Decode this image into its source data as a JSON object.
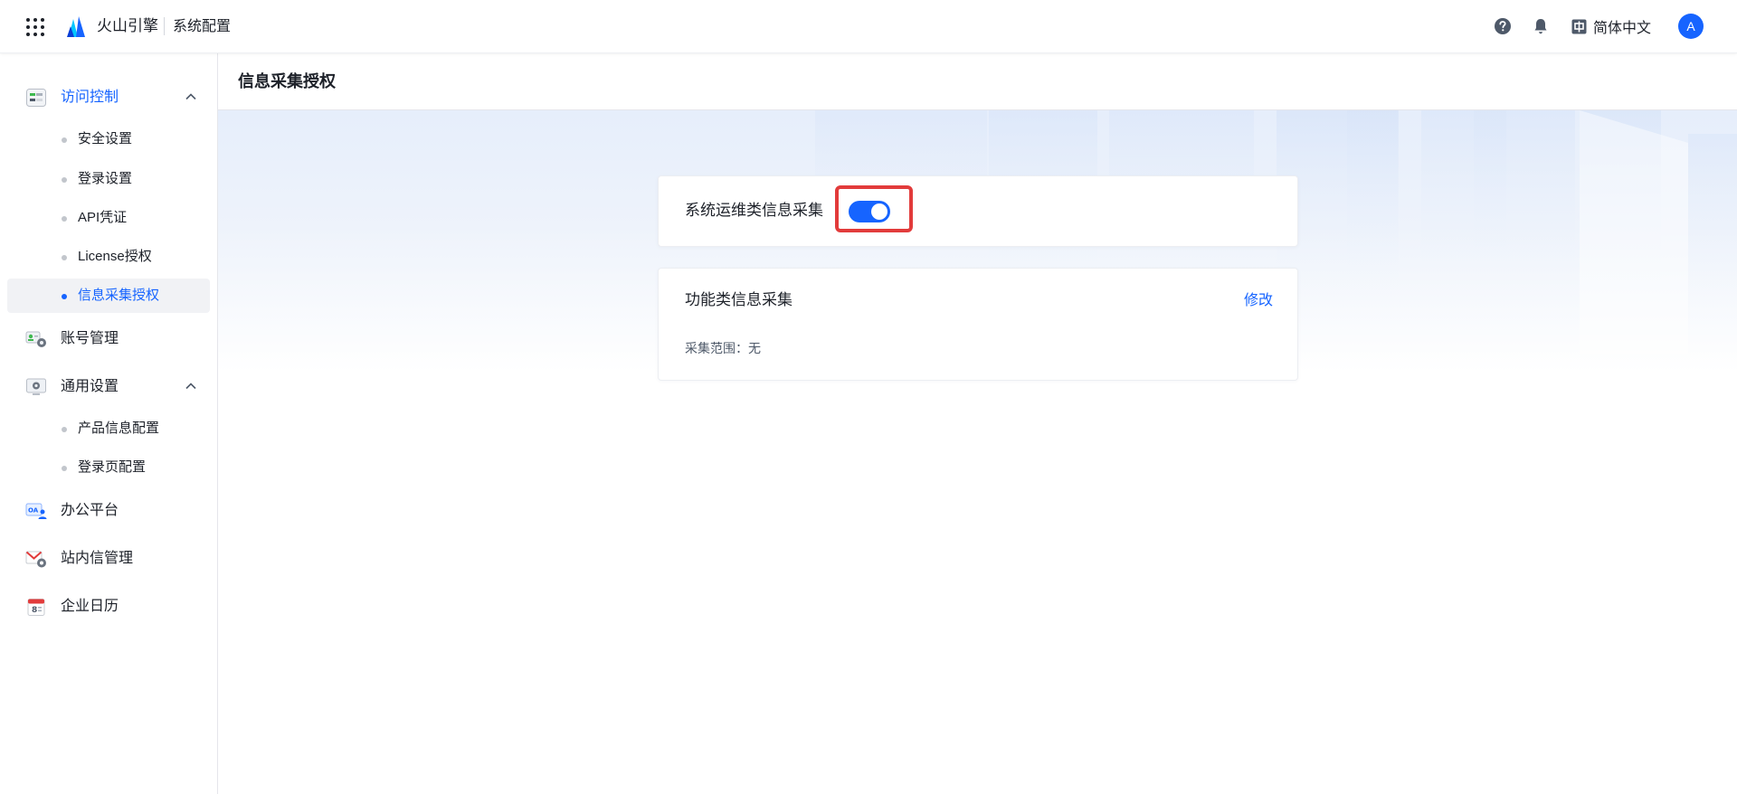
{
  "header": {
    "brand_name": "火山引擎",
    "page_name": "系统配置",
    "language": "简体中文",
    "avatar_letter": "A",
    "icons": [
      "apps-grid-icon",
      "volcano-logo",
      "help-icon",
      "bell-icon",
      "language-icon"
    ]
  },
  "sidebar": {
    "access_control": {
      "label": "访问控制",
      "children": [
        "安全设置",
        "登录设置",
        "API凭证",
        "License授权",
        "信息采集授权"
      ]
    },
    "account_mgmt": {
      "label": "账号管理"
    },
    "general_settings": {
      "label": "通用设置",
      "children": [
        "产品信息配置",
        "登录页配置"
      ]
    },
    "office_platform": {
      "label": "办公平台"
    },
    "mail_mgmt": {
      "label": "站内信管理"
    },
    "calendar": {
      "label": "企业日历"
    },
    "selected_item": "信息采集授权"
  },
  "main": {
    "title": "信息采集授权",
    "ops_card": {
      "title": "系统运维类信息采集",
      "switch_on": true
    },
    "func_card": {
      "title": "功能类信息采集",
      "edit": "修改",
      "scope": "采集范围：无"
    }
  },
  "colors": {
    "accent": "#1664ff",
    "highlight": "#e23b3b",
    "text": "#1d2129"
  }
}
